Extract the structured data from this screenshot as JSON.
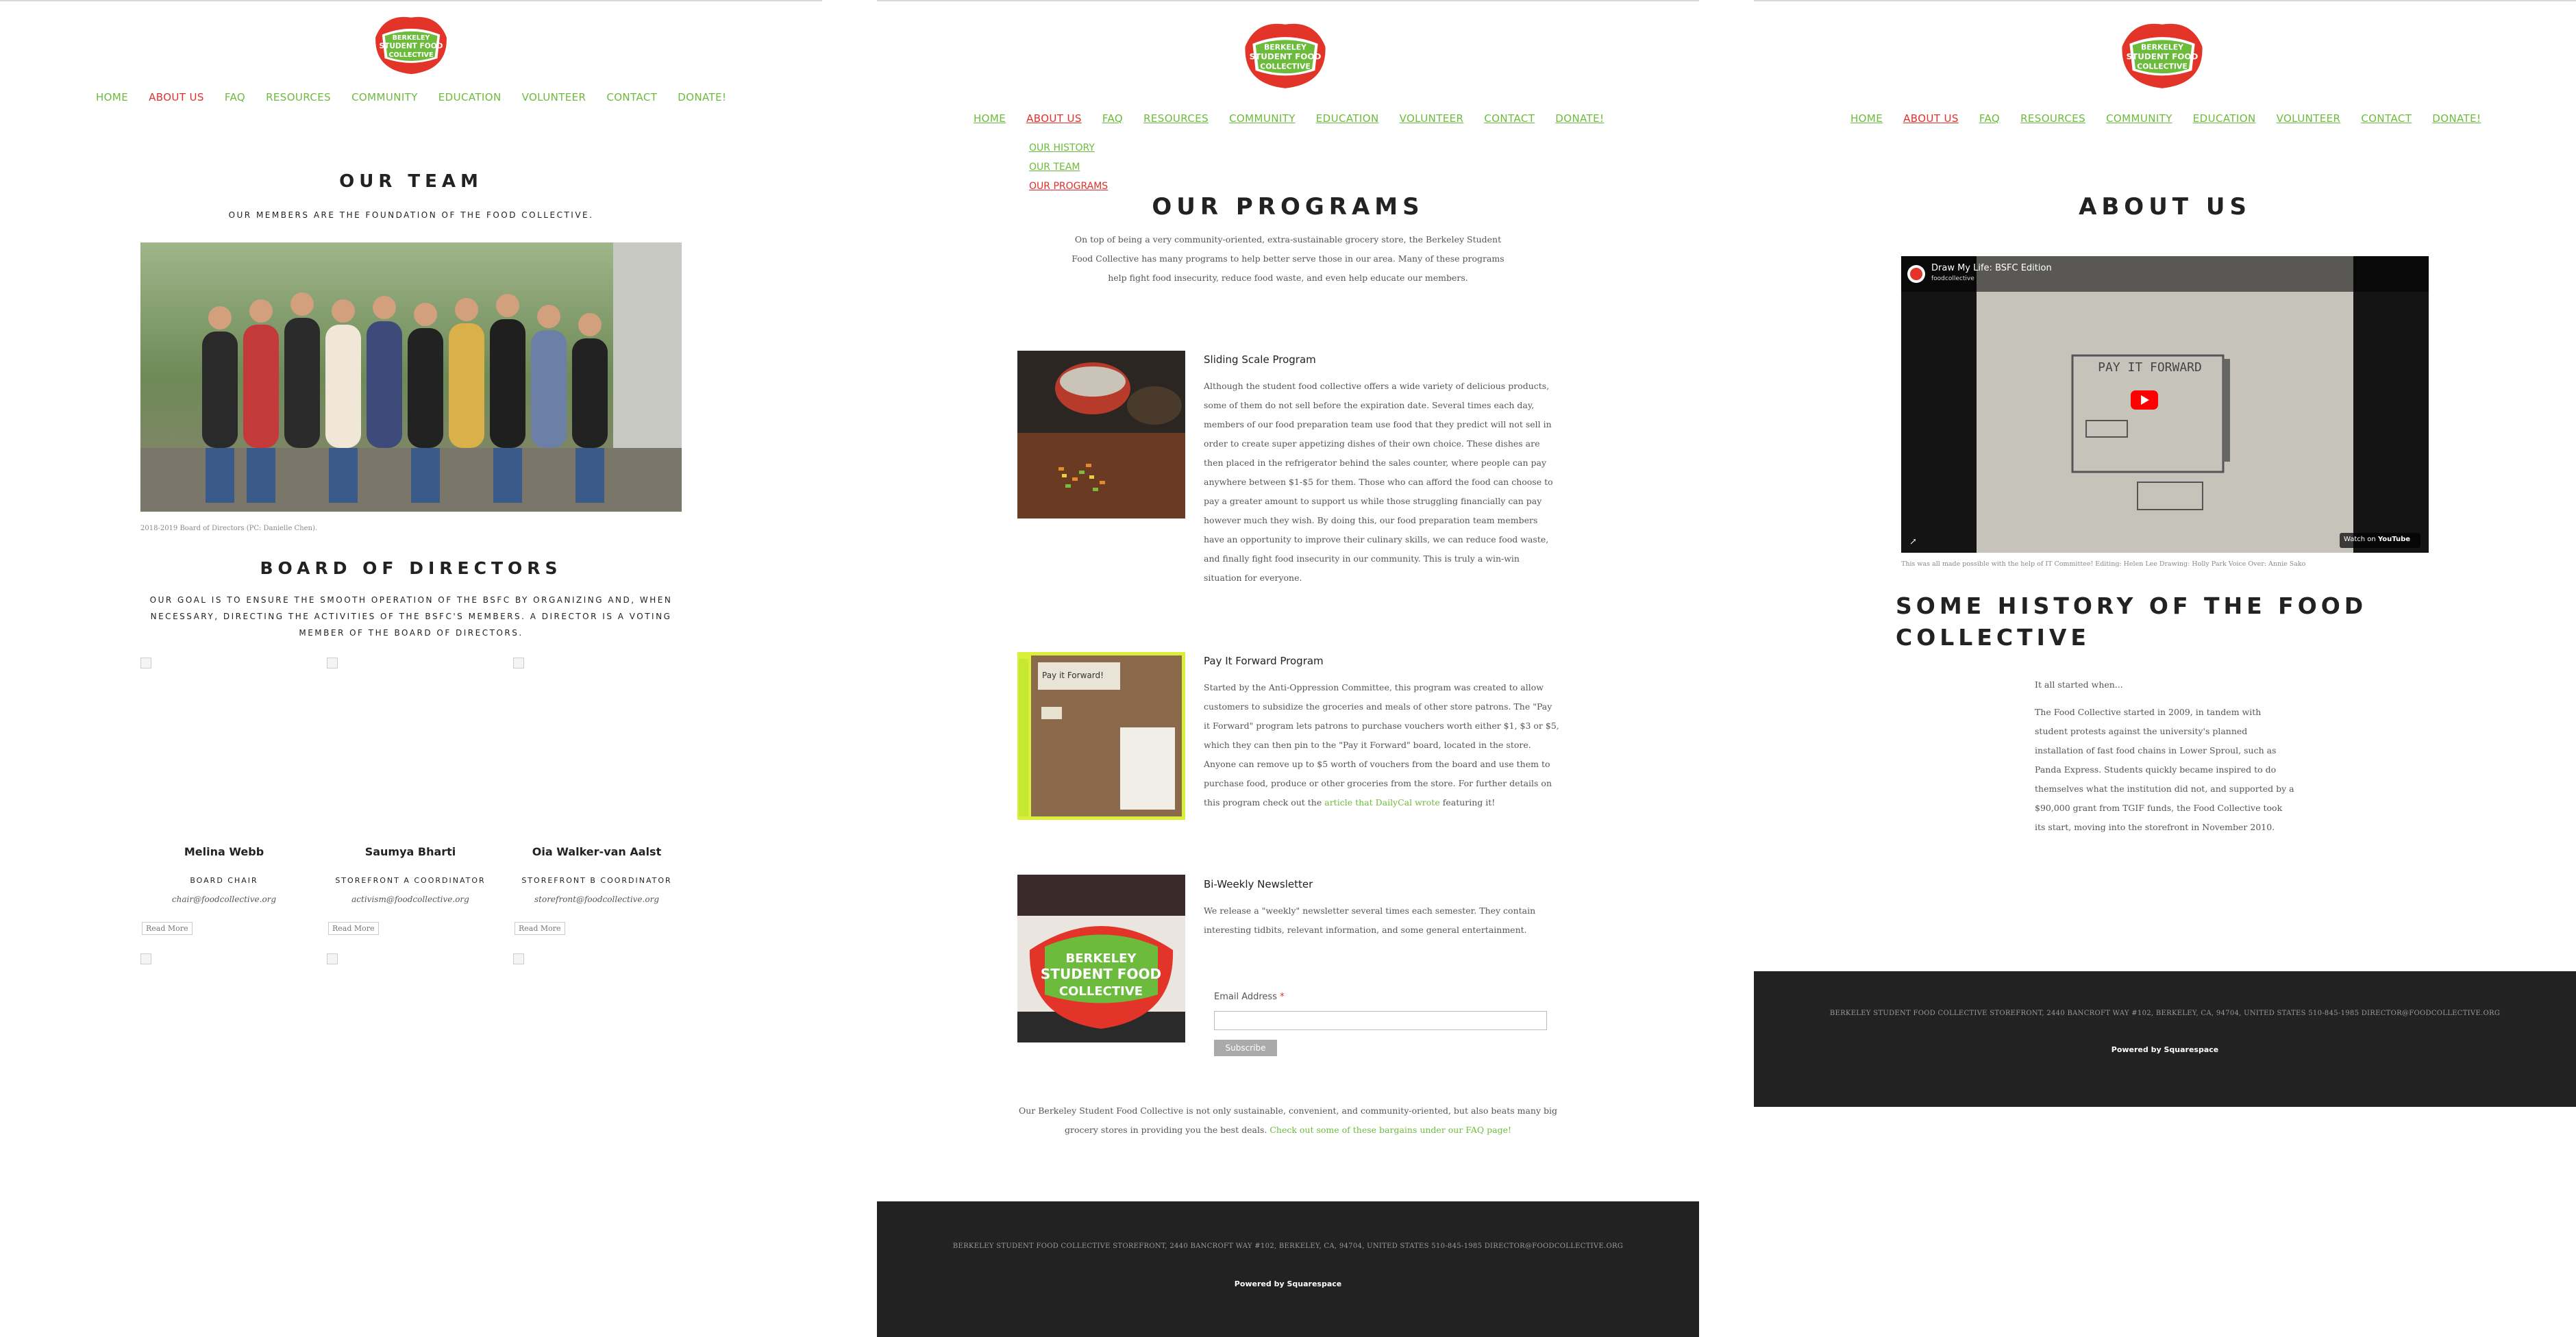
{
  "nav": [
    "HOME",
    "ABOUT US",
    "FAQ",
    "RESOURCES",
    "COMMUNITY",
    "EDUCATION",
    "VOLUNTEER",
    "CONTACT",
    "DONATE!"
  ],
  "nav_active": "ABOUT US",
  "colors": {
    "green": "#6cbb3c",
    "red": "#e0302c",
    "footer": "#222222"
  },
  "logo": {
    "text_lines": [
      "BERKELEY",
      "STUDENT FOOD",
      "COLLECTIVE"
    ]
  },
  "team_page": {
    "title": "OUR TEAM",
    "subtitle": "OUR MEMBERS ARE THE FOUNDATION OF THE FOOD COLLECTIVE.",
    "photo_caption": "2018-2019 Board of Directors (PC: Danielle Chen).",
    "board_title": "BOARD OF DIRECTORS",
    "board_desc": "OUR GOAL IS TO ENSURE THE SMOOTH OPERATION OF THE BSFC BY ORGANIZING AND, WHEN NECESSARY, DIRECTING THE ACTIVITIES OF THE BSFC'S MEMBERS. A DIRECTOR IS A VOTING MEMBER OF THE BOARD OF DIRECTORS.",
    "members": [
      {
        "name": "Melina Webb",
        "role": "BOARD CHAIR",
        "email": "chair@foodcollective.org"
      },
      {
        "name": "Saumya Bharti",
        "role": "STOREFRONT A COORDINATOR",
        "email": "activism@foodcollective.org"
      },
      {
        "name": "Oia Walker-van Aalst",
        "role": "STOREFRONT B COORDINATOR",
        "email": "storefront@foodcollective.org"
      }
    ],
    "read_more": "Read More"
  },
  "programs_page": {
    "subnav": [
      "OUR HISTORY",
      "OUR TEAM",
      "OUR PROGRAMS"
    ],
    "subnav_active": "OUR PROGRAMS",
    "title": "OUR PROGRAMS",
    "intro": "On top of being a very community-oriented, extra-sustainable grocery store, the Berkeley Student Food Collective has many programs to help better serve those in our area. Many of these programs help fight food insecurity, reduce food waste, and even help educate our members.",
    "programs": [
      {
        "title": "Sliding Scale Program",
        "text": "Although the student food collective offers a wide variety of delicious products, some of them do not sell before the expiration date. Several times each day, members of our food preparation team use food that they predict will not sell in order to create super appetizing dishes of their own choice. These dishes are then placed in the refrigerator behind the sales counter, where people can pay anywhere between $1-$5 for them. Those who can afford the food can choose to pay a greater amount to support us while those struggling financially can pay however much they wish. By doing this, our food preparation team members have an opportunity to improve their culinary skills, we can reduce food waste, and finally fight food insecurity in our community. This is truly a win-win situation for everyone."
      },
      {
        "title": "Pay It Forward Program",
        "text": "Started by the Anti-Oppression Committee, this program was created to allow customers to subsidize the groceries and meals of other store patrons. The \"Pay it Forward\" program lets patrons to purchase vouchers worth either $1, $3 or $5, which they can then pin to the \"Pay it Forward\" board, located in the store. Anyone can remove up to $5 worth of vouchers from the board and use them to purchase food, produce or other groceries from the store. For further details on this program check out the",
        "link": "article that DailyCal wrote",
        "after": "featuring it!"
      },
      {
        "title": "Bi-Weekly Newsletter",
        "text": "We release a \"weekly\" newsletter several times each semester. They contain interesting tidbits, relevant information, and some general entertainment."
      }
    ],
    "email_label": "Email Address",
    "required_mark": "*",
    "subscribe": "Subscribe",
    "outro": "Our Berkeley Student Food Collective is not only sustainable, convenient, and community-oriented, but also beats many big grocery stores in providing you the best deals.",
    "outro_link": "Check out some of these bargains under our FAQ page!"
  },
  "about_page": {
    "title": "ABOUT US",
    "video_title": "Draw My Life: BSFC Edition",
    "video_channel": "foodcollective",
    "video_watch": "Watch on",
    "video_brand": "YouTube",
    "board_word": "PAY IT FORWARD",
    "video_caption": "This was all made possible with the help of IT Committee! Editing: Helen Lee Drawing: Holly Park Voice Over: Annie Sako",
    "history_title": "SOME HISTORY OF THE FOOD COLLECTIVE",
    "history_lead": "It all started when...",
    "history_text": "The Food Collective started in 2009, in tandem with student protests against the university's planned installation of fast food chains in Lower Sproul, such as Panda Express. Students quickly became inspired to do themselves what the institution did not, and supported by a $90,000 grant from TGIF funds, the Food Collective took its start, moving into the storefront in November 2010."
  },
  "footer": {
    "address": "BERKELEY STUDENT FOOD COLLECTIVE STOREFRONT, 2440 BANCROFT WAY #102, BERKELEY, CA, 94704, UNITED STATES     510-845-1985     DIRECTOR@FOODCOLLECTIVE.ORG",
    "powered": "Powered by Squarespace"
  }
}
